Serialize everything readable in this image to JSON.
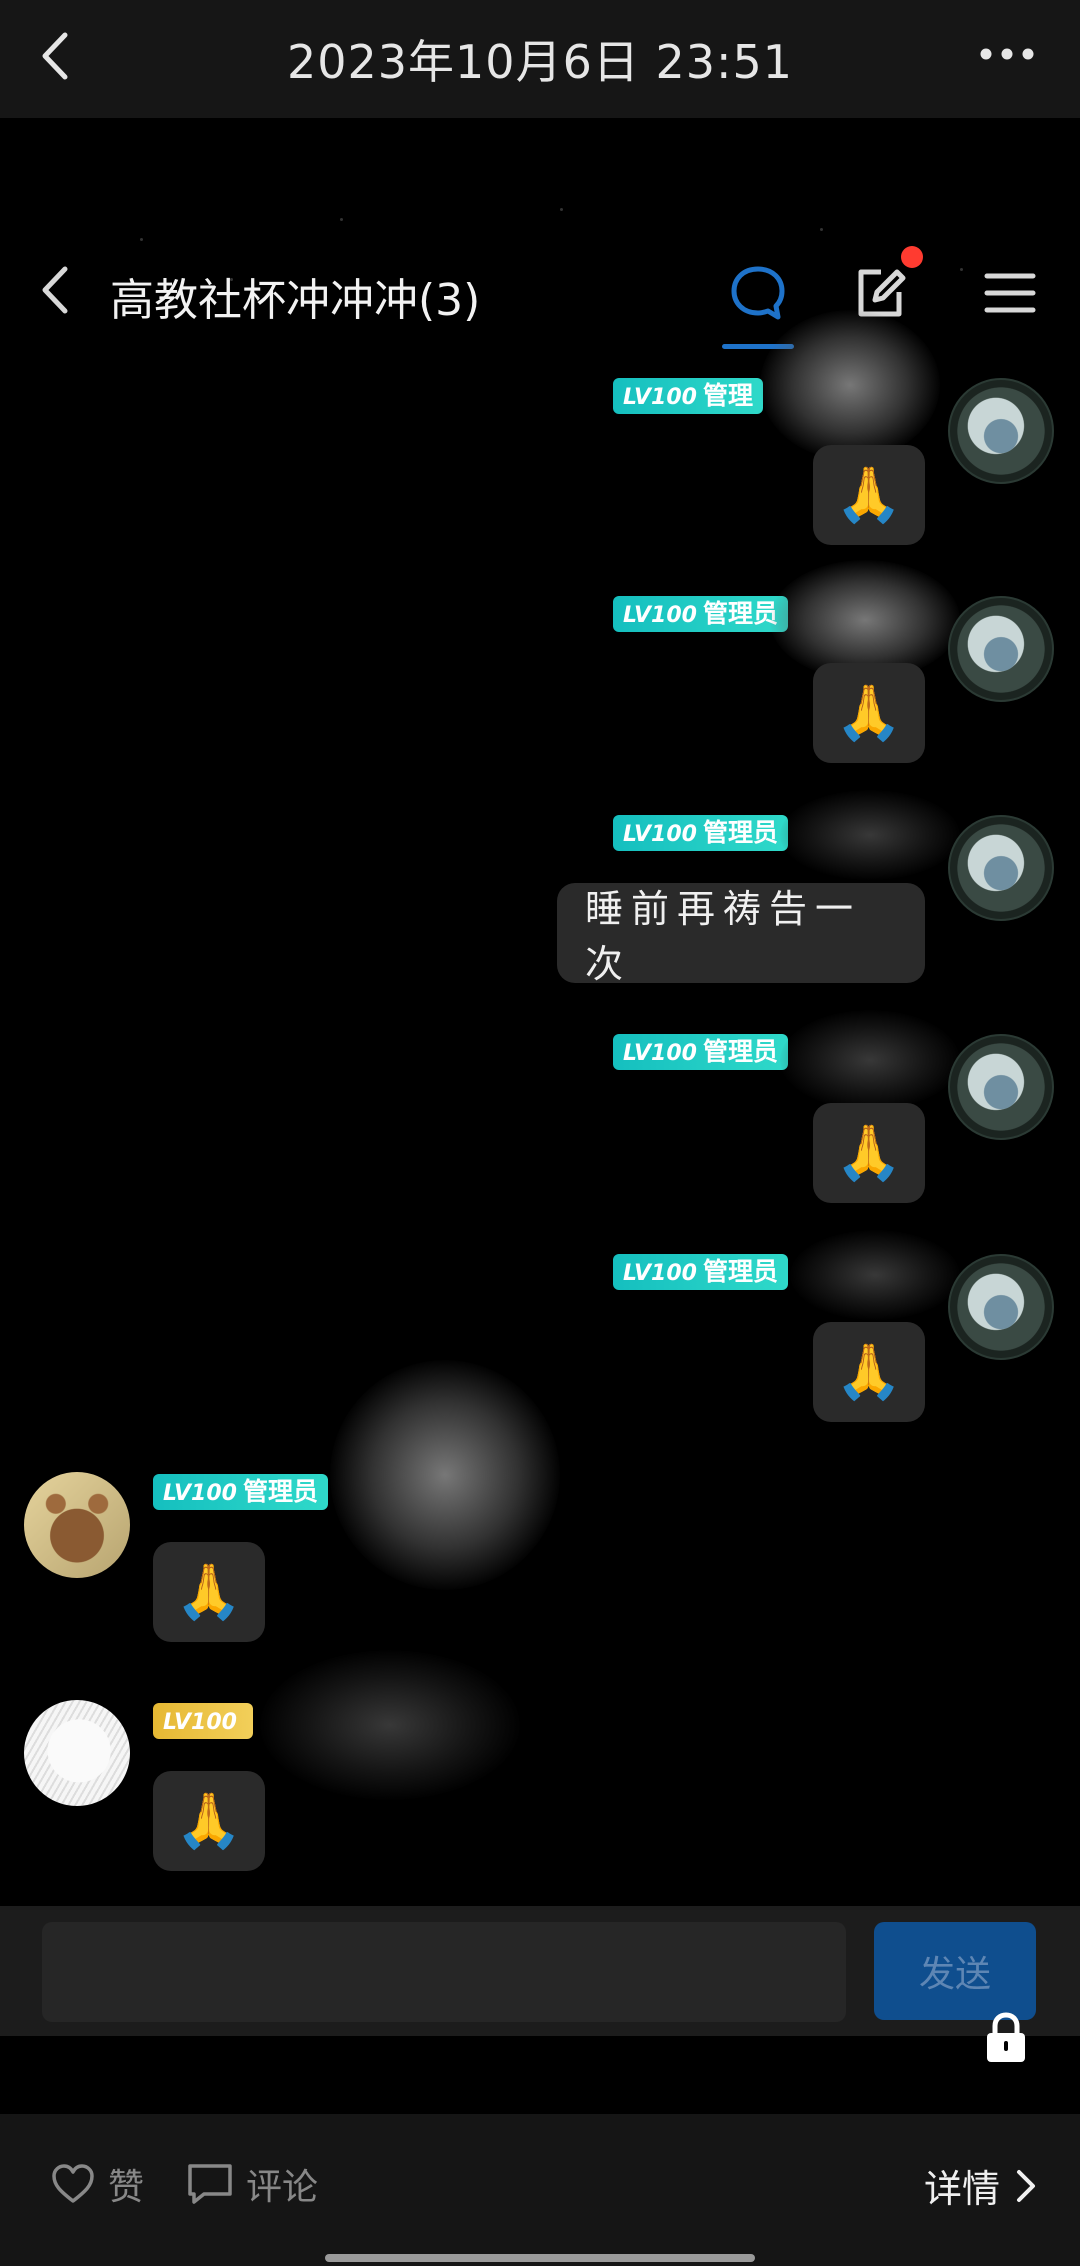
{
  "topbar": {
    "title": "2023年10月6日 23:51",
    "back_icon": "chevron-left-icon",
    "more_icon": "more-horizontal-icon"
  },
  "chat": {
    "title": "高教社杯冲冲冲(3)",
    "accent_color": "#1e72c9",
    "notification_color": "#ff3b30"
  },
  "messages": [
    {
      "side": "right",
      "badge_lv": "LV100",
      "badge_role": "管理",
      "content": "🙏"
    },
    {
      "side": "right",
      "badge_lv": "LV100",
      "badge_role": "管理员",
      "content": "🙏"
    },
    {
      "side": "right",
      "badge_lv": "LV100",
      "badge_role": "管理员",
      "content": "睡前再祷告一次"
    },
    {
      "side": "right",
      "badge_lv": "LV100",
      "badge_role": "管理员",
      "content": "🙏"
    },
    {
      "side": "right",
      "badge_lv": "LV100",
      "badge_role": "管理员",
      "content": "🙏"
    },
    {
      "side": "left",
      "badge_lv": "LV100",
      "badge_role": "管理员",
      "content": "🙏"
    },
    {
      "side": "left",
      "badge_lv": "LV100",
      "badge_role": "",
      "content": "🙏"
    }
  ],
  "input": {
    "placeholder": "",
    "send_label": "发送"
  },
  "bottom": {
    "like_label": "赞",
    "comment_label": "评论",
    "detail_label": "详情"
  }
}
